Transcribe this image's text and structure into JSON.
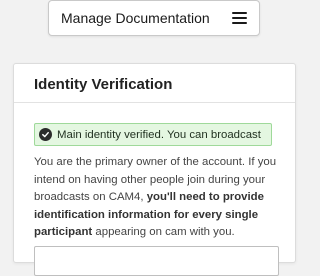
{
  "menu": {
    "label": "Manage Documentation",
    "icon": "hamburger-icon"
  },
  "card": {
    "title": "Identity Verification",
    "alert": {
      "icon": "check-circle-icon",
      "text": "Main identity verified. You can broadcast",
      "background": "#e4f7e1",
      "border": "#9fd99a"
    },
    "description": {
      "part1": "You are the primary owner of the account. If you intend on having other people join during your broadcasts on CAM4, ",
      "bold1": "you'll need to provide identification information for every single participant",
      "part2": " appearing on cam with you."
    }
  }
}
